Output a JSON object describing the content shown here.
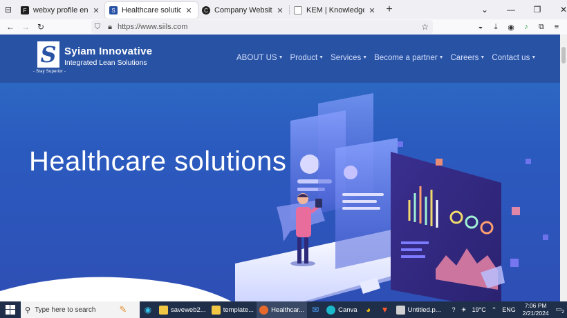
{
  "browser": {
    "tabs": [
      {
        "title": "webxy profile english – Figma",
        "icon": "figma-icon",
        "color": "#1e1e1e",
        "active": false
      },
      {
        "title": "Healthcare solutions | integrate",
        "icon": "siils-favicon",
        "color": "#2853a5",
        "active": true
      },
      {
        "title": "Company Website Business We",
        "icon": "canva-favicon",
        "color": "#222222",
        "active": false
      },
      {
        "title": "KEM | Knowledge Event For Ma",
        "icon": "page-icon",
        "color": "#888888",
        "active": false
      }
    ],
    "url": "https://www.siils.com"
  },
  "site": {
    "brand_name": "Syiam Innovative",
    "brand_sub": "Integrated Lean Solutions",
    "tagline": "- Stay Superior -",
    "menu": [
      "ABOUT US",
      "Product",
      "Services",
      "Become a partner",
      "Careers",
      "Contact us"
    ],
    "hero_title": "Healthcare solutions"
  },
  "taskbar": {
    "search_placeholder": "Type here to search",
    "apps": [
      {
        "label": "saveweb2...",
        "color": "#f2c744"
      },
      {
        "label": "template...",
        "color": "#f2c744"
      },
      {
        "label": "Healthcar...",
        "color": "#e66a2c",
        "active": true
      },
      {
        "label": "Canva",
        "color": "#1ab8c9"
      },
      {
        "label": "Untitled.p...",
        "color": "#d0d0d0"
      }
    ],
    "weather": "19°C",
    "language": "ENG",
    "time": "7:06 PM",
    "date": "2/21/2024",
    "notifications": "2"
  }
}
